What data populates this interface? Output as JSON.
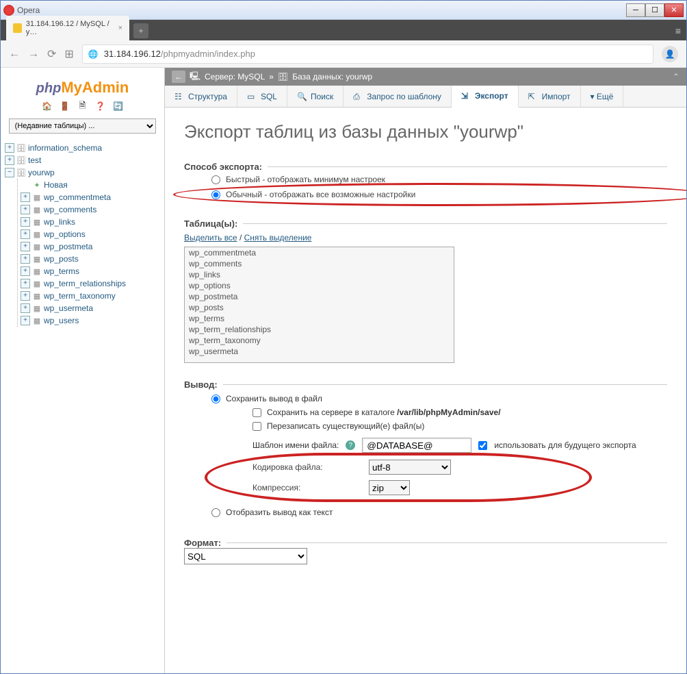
{
  "window": {
    "title": "Opera"
  },
  "browser": {
    "tab_title": "31.184.196.12 / MySQL / y…",
    "url_prefix": "31.184.196.12",
    "url_path": "/phpmyadmin/index.php"
  },
  "logo": {
    "php": "php",
    "my": "My",
    "admin": "Admin"
  },
  "sidebar": {
    "recent_placeholder": "(Недавние таблицы) ...",
    "databases": [
      {
        "name": "information_schema",
        "expanded": false
      },
      {
        "name": "test",
        "expanded": false
      },
      {
        "name": "yourwp",
        "expanded": true,
        "new_label": "Новая",
        "tables": [
          "wp_commentmeta",
          "wp_comments",
          "wp_links",
          "wp_options",
          "wp_postmeta",
          "wp_posts",
          "wp_terms",
          "wp_term_relationships",
          "wp_term_taxonomy",
          "wp_usermeta",
          "wp_users"
        ]
      }
    ]
  },
  "breadcrumb": {
    "server_label": "Сервер: MySQL",
    "db_label": "База данных: yourwp"
  },
  "topnav": {
    "items": [
      {
        "label": "Структура",
        "icon": "structure-icon"
      },
      {
        "label": "SQL",
        "icon": "sql-icon"
      },
      {
        "label": "Поиск",
        "icon": "search-icon"
      },
      {
        "label": "Запрос по шаблону",
        "icon": "query-icon"
      },
      {
        "label": "Экспорт",
        "icon": "export-icon",
        "active": true
      },
      {
        "label": "Импорт",
        "icon": "import-icon"
      },
      {
        "label": "Ещё",
        "icon": "more-icon"
      }
    ]
  },
  "page": {
    "title": "Экспорт таблиц из базы данных \"yourwp\"",
    "export_method": {
      "legend": "Способ экспорта:",
      "quick": "Быстрый - отображать минимум настроек",
      "custom": "Обычный - отображать все возможные настройки"
    },
    "tables": {
      "legend": "Таблица(ы):",
      "select_all": "Выделить все",
      "unselect_all": "Снять выделение",
      "list": [
        "wp_commentmeta",
        "wp_comments",
        "wp_links",
        "wp_options",
        "wp_postmeta",
        "wp_posts",
        "wp_terms",
        "wp_term_relationships",
        "wp_term_taxonomy",
        "wp_usermeta"
      ]
    },
    "output": {
      "legend": "Вывод:",
      "save_to_file": "Сохранить вывод в файл",
      "save_on_server": "Сохранить на сервере в каталоге ",
      "server_path": "/var/lib/phpMyAdmin/save/",
      "overwrite": "Перезаписать существующий(е) файл(ы)",
      "filename_template_label": "Шаблон имени файла:",
      "filename_template_value": "@DATABASE@",
      "use_for_future": "использовать для будущего экспорта",
      "encoding_label": "Кодировка файла:",
      "encoding_value": "utf-8",
      "compression_label": "Компрессия:",
      "compression_value": "zip",
      "view_as_text": "Отобразить вывод как текст"
    },
    "format": {
      "legend": "Формат:",
      "value": "SQL"
    }
  }
}
